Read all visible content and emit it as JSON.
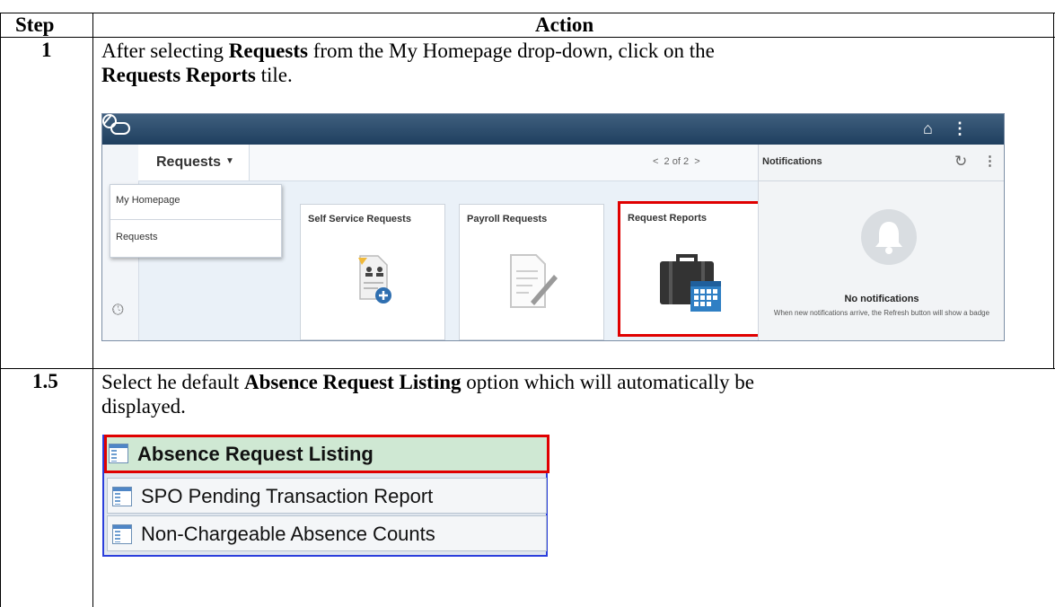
{
  "table": {
    "headers": {
      "step": "Step",
      "action": "Action"
    },
    "rows": [
      {
        "step": "1",
        "text_pre": "After selecting ",
        "bold1": "Requests",
        "text_mid": " from the My Homepage drop-down, click on the",
        "bold2": "Requests Reports",
        "text_post": " tile."
      },
      {
        "step": "1.5",
        "text_pre": "Select he default ",
        "bold1": "Absence Request Listing",
        "text_post": " option which will automatically be",
        "text_line2": "displayed."
      }
    ]
  },
  "screenshot1": {
    "homepage_selector": "Requests",
    "pager": "2 of 2",
    "menu_items": [
      "My Homepage",
      "Requests"
    ],
    "tiles": [
      "Self Service Requests",
      "Payroll Requests",
      "Request Reports"
    ],
    "notifications": {
      "title": "Notifications",
      "empty_title": "No notifications",
      "empty_desc": "When new notifications arrive, the Refresh button will show a badge"
    },
    "icons": [
      "oracle-logo",
      "home-icon",
      "more-icon",
      "navbar-icon",
      "clock-icon",
      "heart-icon",
      "refresh-icon",
      "bell-icon"
    ],
    "highlight_color": "#e00000"
  },
  "screenshot2": {
    "items": [
      "Absence Request Listing",
      "SPO Pending Transaction Report",
      "Non-Chargeable Absence Counts"
    ],
    "selected_bg": "#cfe8d3",
    "highlight_color": "#e00000"
  }
}
